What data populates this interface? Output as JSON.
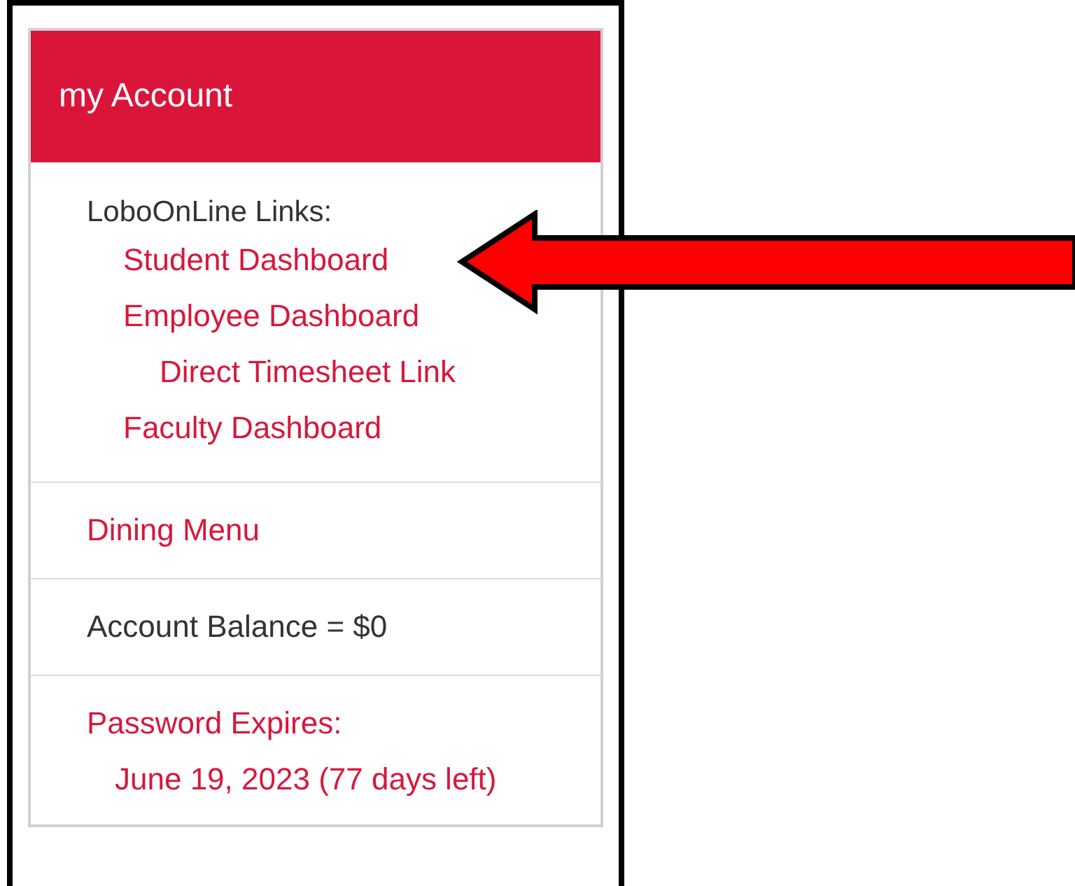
{
  "panel": {
    "title": "my Account"
  },
  "links_section": {
    "heading": "LoboOnLine Links:",
    "links": [
      {
        "label": "Student Dashboard"
      },
      {
        "label": "Employee Dashboard",
        "children": [
          {
            "label": "Direct Timesheet Link"
          }
        ]
      },
      {
        "label": "Faculty Dashboard"
      }
    ]
  },
  "dining_link": "Dining Menu",
  "balance": "Account Balance = $0",
  "password": {
    "label": "Password Expires:",
    "date": "June 19, 2023 (77 days left)"
  }
}
